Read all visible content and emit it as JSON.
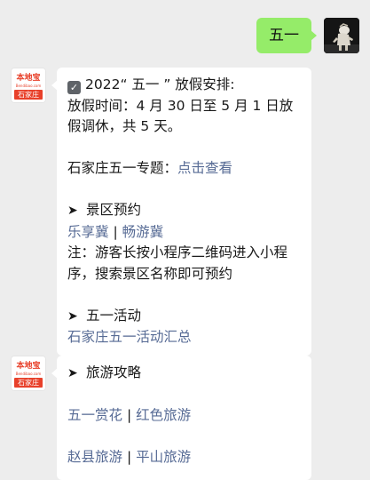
{
  "self_message": {
    "text": "五一"
  },
  "bot": {
    "logo": {
      "name": "本地宝",
      "url": "Bendibao.com",
      "city": "石家庄"
    }
  },
  "message1": {
    "check_icon": "✓",
    "heading": "2022“ 五一 ” 放假安排:",
    "holiday_text": "放假时间：4 月 30 日至 5 月 1 日放假调休，共 5 天。",
    "special_label": "石家庄五一专题：",
    "special_link": "点击查看",
    "arrow_icon": "➤",
    "section_scenic": "景区预约",
    "link_lexiangji": "乐享冀",
    "separator": "|",
    "link_changyouji": "畅游冀",
    "note": "注：游客长按小程序二维码进入小程序，搜索景区名称即可预约",
    "section_events": "五一活动",
    "link_events": "石家庄五一活动汇总"
  },
  "message2": {
    "arrow_icon": "➤",
    "section_travel": "旅游攻略",
    "link_flowers": "五一赏花",
    "separator": "|",
    "link_red": "红色旅游",
    "link_zhaoxian": "赵县旅游",
    "link_pingshan": "平山旅游"
  }
}
